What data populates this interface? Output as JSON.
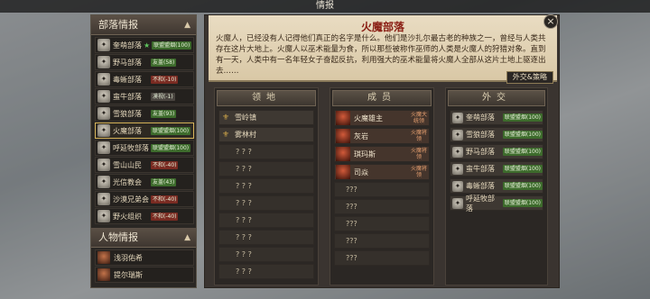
{
  "window_title": "情报",
  "left": {
    "tribe_section_title": "部落情报",
    "tribes": [
      {
        "name": "奎萌部落",
        "rel": "联盟盟烟(100)",
        "tone": "green",
        "star": "★"
      },
      {
        "name": "野马部落",
        "rel": "友盖(58)",
        "tone": "green"
      },
      {
        "name": "毒蜥部落",
        "rel": "不和(-10)",
        "tone": "red"
      },
      {
        "name": "蛮牛部落",
        "rel": "漠视(-1)",
        "tone": "gray"
      },
      {
        "name": "雪狼部落",
        "rel": "友盖(93)",
        "tone": "green"
      },
      {
        "name": "火魔部落",
        "rel": "联盟盟烟(100)",
        "tone": "green"
      },
      {
        "name": "呼延牧部落",
        "rel": "联盟盟烟(100)",
        "tone": "green"
      },
      {
        "name": "雪山山民",
        "rel": "不和(-40)",
        "tone": "red"
      },
      {
        "name": "光信教会",
        "rel": "友盖(43)",
        "tone": "green"
      },
      {
        "name": "沙漠兄弟会",
        "rel": "不和(-40)",
        "tone": "red"
      },
      {
        "name": "野火组织",
        "rel": "不和(-40)",
        "tone": "red"
      }
    ],
    "person_section_title": "人物情报",
    "persons": [
      {
        "name": "浅羽佑希"
      },
      {
        "name": "提尔瑞斯"
      }
    ]
  },
  "main": {
    "title": "火魔部落",
    "description": "火魔人，已经没有人记得他们真正的名字是什么。他们是沙扎尔最古老的种族之一，曾经与人类共存在这片大地上。火魔人以巫术能量为食，所以那些被称作巫师的人类是火魔人的狩猎对象。直到有一天，人类中有一名年轻女子奋起反抗，利用强大的巫术能量将火魔人全部从这片土地上驱逐出去……",
    "diplomacy_button": "外交&策略",
    "territory": {
      "header": "领地",
      "items": [
        "雪岭镇",
        "雾林村",
        "? ? ?",
        "? ? ?",
        "? ? ?",
        "? ? ?",
        "? ? ?",
        "? ? ?",
        "? ? ?",
        "? ? ?"
      ]
    },
    "members": {
      "header": "成员",
      "items": [
        {
          "name": "火魔雄主",
          "role": "火魔大统领"
        },
        {
          "name": "灰岩",
          "role": "火魔将领"
        },
        {
          "name": "琪玛斯",
          "role": "火魔将领"
        },
        {
          "name": "司焱",
          "role": "火魔将领"
        }
      ],
      "unknown": [
        "???",
        "???",
        "???",
        "???",
        "???"
      ]
    },
    "diplomacy": {
      "header": "外交",
      "items": [
        {
          "name": "奎萌部落",
          "rel": "联盟盟烟(100)"
        },
        {
          "name": "雪狼部落",
          "rel": "联盟盟烟(100)"
        },
        {
          "name": "野马部落",
          "rel": "联盟盟烟(100)"
        },
        {
          "name": "蛮牛部落",
          "rel": "联盟盟烟(100)"
        },
        {
          "name": "毒蜥部落",
          "rel": "联盟盟烟(100)"
        },
        {
          "name": "呼延牧部落",
          "rel": "联盟盟烟(100)"
        }
      ]
    }
  }
}
